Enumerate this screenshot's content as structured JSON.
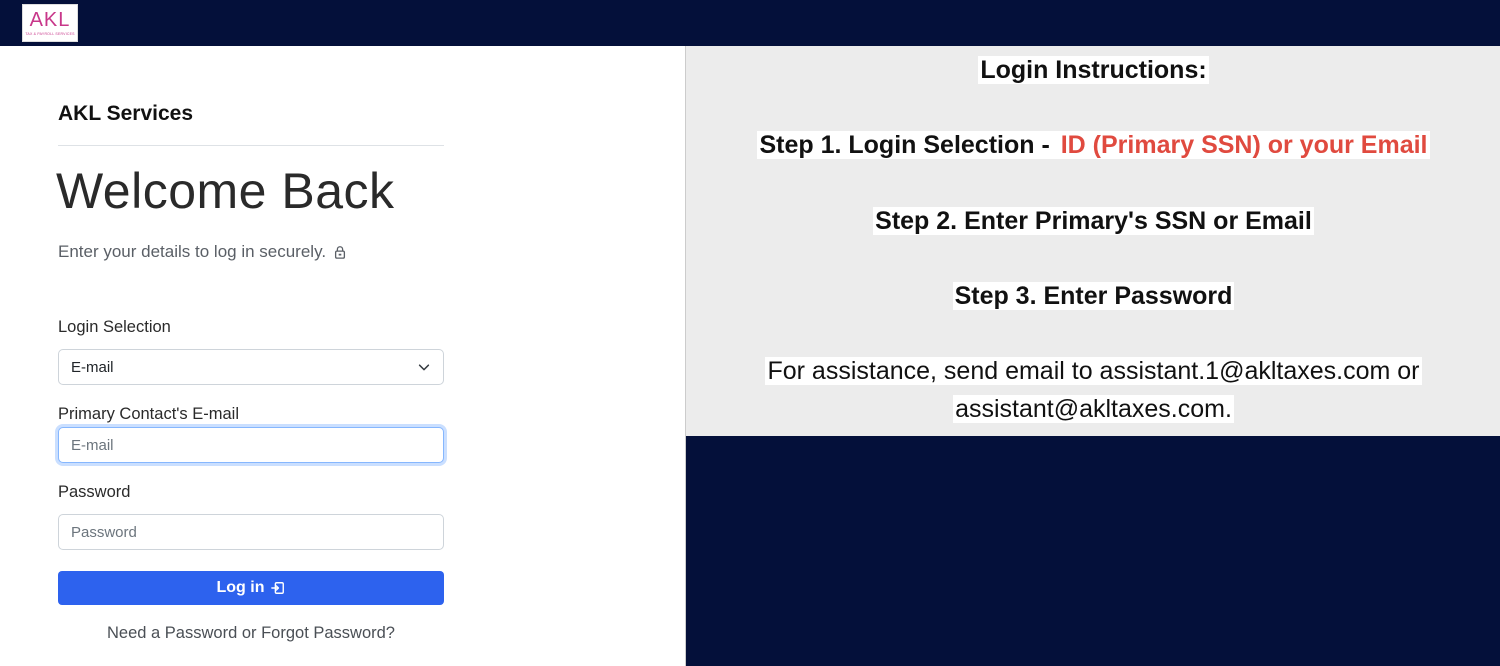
{
  "logo": {
    "mark": "AKL",
    "tagline": "TAX & PAYROLL SERVICES"
  },
  "form": {
    "brand": "AKL Services",
    "heading": "Welcome Back",
    "subtitle": "Enter your details to log in securely.",
    "login_selection_label": "Login Selection",
    "login_selection_value": "E-mail",
    "email_label": "Primary Contact's E-mail",
    "email_placeholder": "E-mail",
    "password_label": "Password",
    "password_placeholder": "Password",
    "login_button": "Log in",
    "forgot_link": "Need a Password or Forgot Password?"
  },
  "instructions": {
    "title": "Login Instructions:",
    "step1_prefix": "Step 1.  Login Selection - ",
    "step1_highlight": "ID (Primary SSN) or your Email",
    "step2": "Step 2.  Enter Primary's SSN or Email",
    "step3": "Step 3.  Enter Password",
    "assistance_line1": "For assistance, send email to assistant.1@akltaxes.com or",
    "assistance_line2": "assistant@akltaxes.com."
  },
  "colors": {
    "navy": "#04103a",
    "primary_button": "#2d62ee",
    "highlight_red": "#e04a3f",
    "logo_pink": "#c8378a"
  }
}
